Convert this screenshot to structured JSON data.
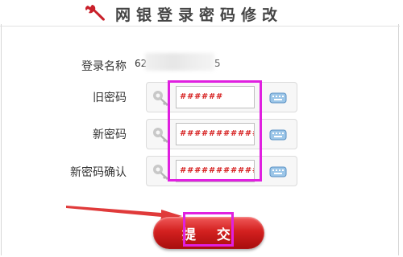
{
  "header": {
    "title": "网银登录密码修改",
    "icon": "wrench-icon"
  },
  "form": {
    "account": {
      "label": "登录名称",
      "value_prefix": "62",
      "value_suffix": "5"
    },
    "old_password": {
      "label": "旧密码",
      "value": "######",
      "icon": "key-icon",
      "keyboard_icon": "keyboard-icon"
    },
    "new_password": {
      "label": "新密码",
      "value": "############",
      "icon": "key-icon",
      "keyboard_icon": "keyboard-icon"
    },
    "confirm_password": {
      "label": "新密码确认",
      "value": "############",
      "icon": "key-icon",
      "keyboard_icon": "keyboard-icon"
    },
    "submit_label": "提 交"
  },
  "colors": {
    "highlight": "#e020e0",
    "arrow": "#e03a3a",
    "button": "#d3201f",
    "password_text": "#d62020"
  }
}
